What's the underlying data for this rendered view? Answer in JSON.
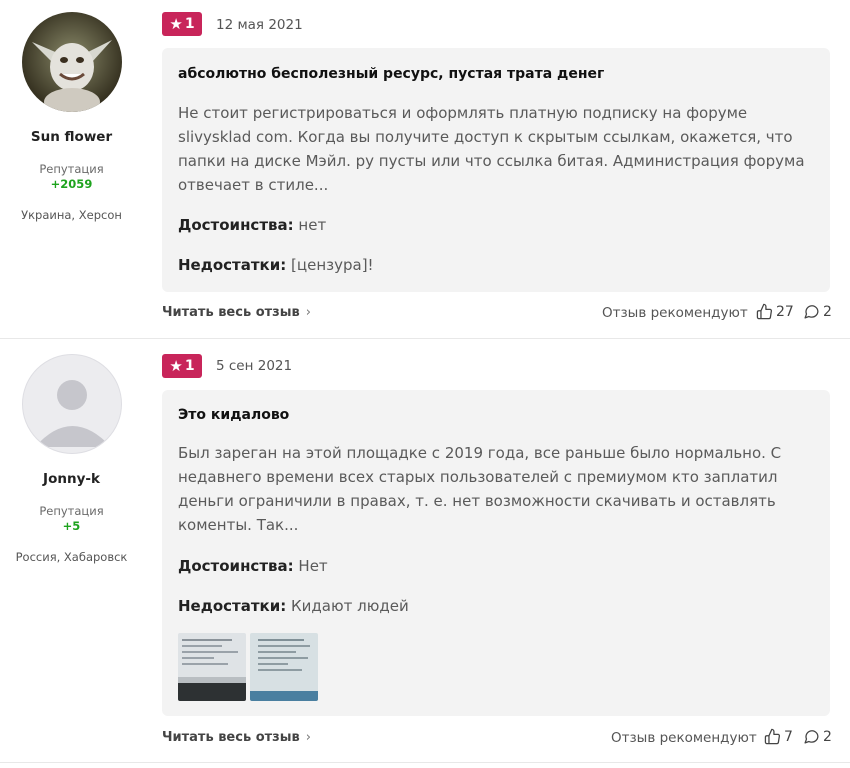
{
  "reviews": [
    {
      "author": {
        "name": "Sun flower",
        "reputation_label": "Репутация",
        "reputation": "+2059",
        "location": "Украина, Херсон",
        "avatar": "goblin-avatar"
      },
      "rating": "1",
      "rating_icon": "star-icon",
      "date": "12 мая 2021",
      "title": "абсолютно бесполезный ресурс, пустая трата денег",
      "body": "Не стоит регистрироваться и оформлять платную подписку на форуме slivysklad com. Когда вы получите доступ к скрытым ссылкам, окажется, что папки на диске Мэйл. ру пусты или что ссылка битая. Администрация форума отвечает в стиле...",
      "pros_label": "Достоинства:",
      "pros": "нет",
      "cons_label": "Недостатки:",
      "cons": "[цензура]!",
      "read_more": "Читать весь отзыв",
      "recommend_label": "Отзыв рекомендуют",
      "likes": "27",
      "comments": "2"
    },
    {
      "author": {
        "name": "Jonny-k",
        "reputation_label": "Репутация",
        "reputation": "+5",
        "location": "Россия, Хабаровск",
        "avatar": "default-user-avatar"
      },
      "rating": "1",
      "rating_icon": "star-icon",
      "date": "5 сен 2021",
      "title": "Это кидалово",
      "body": "Был зареган на этой площадке с 2019 года, все раньше было нормально. С недавнего времени всех старых пользователей с премиумом кто заплатил деньги ограничили в правах, т. е. нет возможности скачивать и оставлять коменты. Так...",
      "pros_label": "Достоинства:",
      "pros": "Нет",
      "cons_label": "Недостатки:",
      "cons": "Кидают людей",
      "photos": [
        "screenshot-photo-1",
        "screenshot-photo-2"
      ],
      "read_more": "Читать весь отзыв",
      "recommend_label": "Отзыв рекомендуют",
      "likes": "7",
      "comments": "2"
    }
  ],
  "colors": {
    "badge": "#c8255a",
    "reputation": "#1ea31e",
    "card": "#f3f3f3"
  }
}
